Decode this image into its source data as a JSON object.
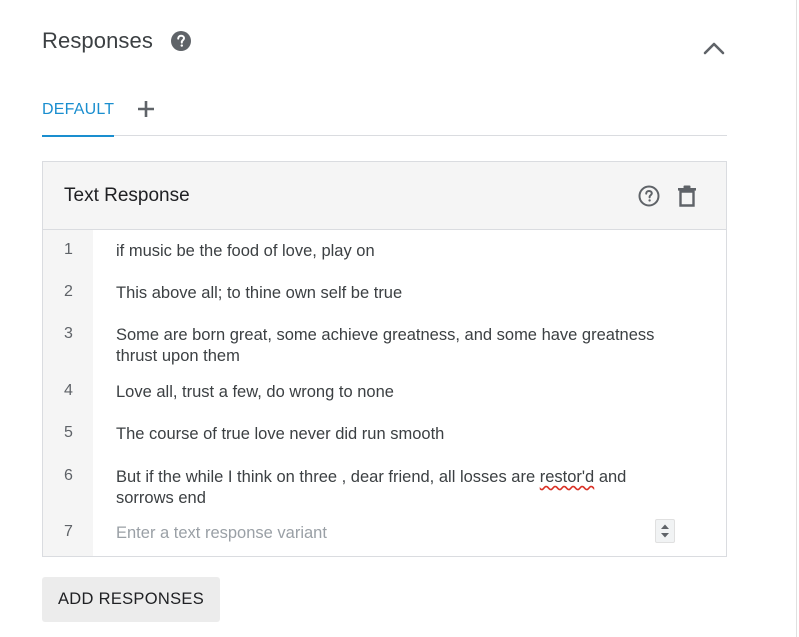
{
  "section": {
    "title": "Responses"
  },
  "tabs": [
    {
      "label": "DEFAULT",
      "active": true
    }
  ],
  "card": {
    "title": "Text Response",
    "rows": [
      {
        "num": "1",
        "text": "if music be the food of love, play on"
      },
      {
        "num": "2",
        "text": "This above all; to thine own self be true"
      },
      {
        "num": "3",
        "text": "Some are born great, some achieve greatness, and some have greatness thrust upon them"
      },
      {
        "num": "4",
        "text": "Love all, trust a few, do wrong to none"
      },
      {
        "num": "5",
        "text": "The course of true love never did run smooth"
      },
      {
        "num": "6",
        "text_before": "But if the while I think on three , dear friend, all losses are ",
        "text_misspelled": "restor'd",
        "text_after": " and sorrows end"
      }
    ],
    "input_row": {
      "num": "7",
      "value": "",
      "placeholder": "Enter a text response variant"
    }
  },
  "footer": {
    "add_responses_label": "ADD RESPONSES"
  },
  "icons": {
    "help": "help-circle-filled-icon",
    "collapse": "chevron-up-icon",
    "add_tab": "plus-icon",
    "card_help": "help-circle-outline-icon",
    "delete": "trash-icon",
    "spinner": "spinner-arrows-icon"
  },
  "colors": {
    "accent": "#1a8ecf",
    "icon": "#5f6368",
    "misspelled_underline": "#d93025"
  }
}
